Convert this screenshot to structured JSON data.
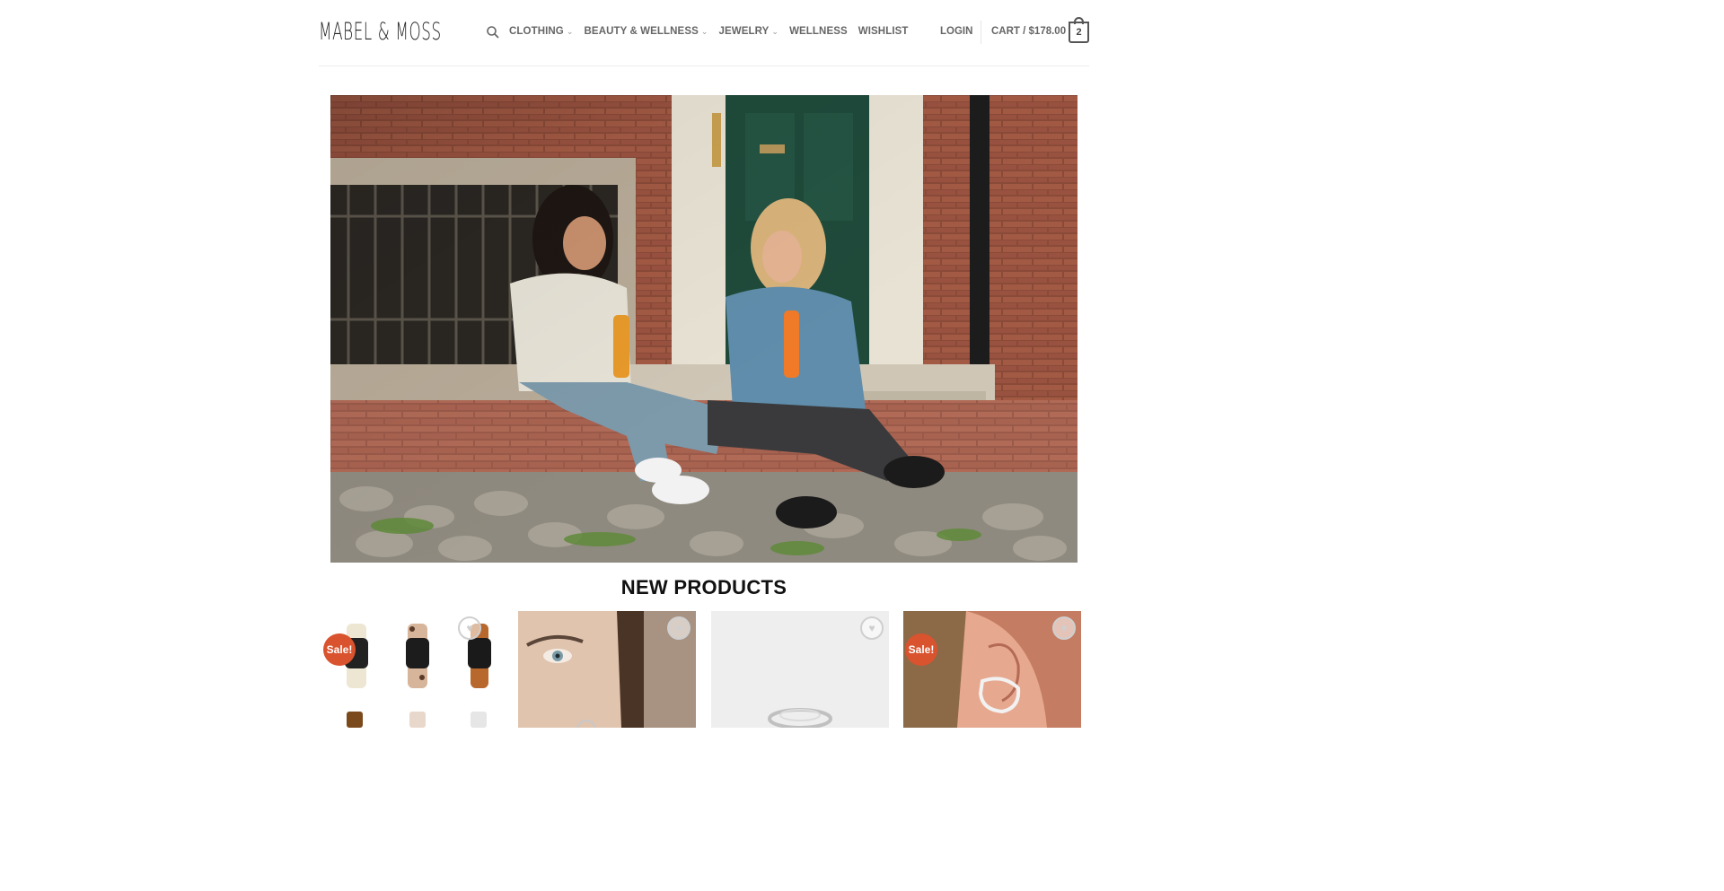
{
  "header": {
    "logo": "MABEL & MOSS",
    "nav": [
      {
        "label": "CLOTHING",
        "has_dropdown": true
      },
      {
        "label": "BEAUTY & WELLNESS",
        "has_dropdown": true
      },
      {
        "label": "JEWELRY",
        "has_dropdown": true
      },
      {
        "label": "WELLNESS",
        "has_dropdown": false
      },
      {
        "label": "WISHLIST",
        "has_dropdown": false
      }
    ],
    "login": "LOGIN",
    "cart_label": "CART / $178.00",
    "cart_count": "2"
  },
  "icons": {
    "search": "search-icon",
    "wishlist": "heart-icon",
    "chevron": "chevron-down-icon"
  },
  "main": {
    "section_title": "NEW PRODUCTS",
    "products": [
      {
        "sale_badge": "Sale!"
      },
      {
        "sale_badge": ""
      },
      {
        "sale_badge": ""
      },
      {
        "sale_badge": "Sale!"
      }
    ]
  },
  "colors": {
    "sale_badge": "#d9532e",
    "nav_text": "#666666",
    "heading": "#111111"
  }
}
